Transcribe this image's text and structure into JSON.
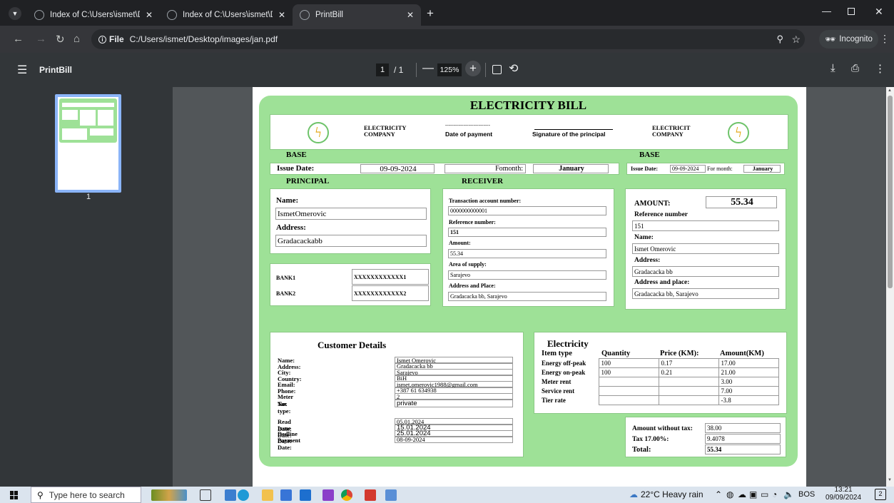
{
  "browser": {
    "tabs": [
      {
        "title": "Index of C:\\Users\\ismet\\Deskto",
        "active": false
      },
      {
        "title": "Index of C:\\Users\\ismet\\Deskto",
        "active": false
      },
      {
        "title": "PrintBill",
        "active": true
      }
    ],
    "new_tab": "+",
    "url_scheme": "File",
    "url": "C:/Users/ismet/Desktop/images/jan.pdf",
    "incognito_label": "Incognito"
  },
  "viewer": {
    "doc_title": "PrintBill",
    "page_current": "1",
    "page_total": "/ 1",
    "zoom": "125%",
    "thumb_label": "1"
  },
  "bill": {
    "title": "ELECTRICITY BILL",
    "header": {
      "company_left": "ELECTRICITY\nCOMPANY",
      "dashes": "---------------------------",
      "date_of_payment": "Date of payment",
      "signature": "Signature of the principal",
      "company_right": "ELECTRICIT\nCOMPANY"
    },
    "base_left": {
      "heading": "BASE",
      "issue_label": "Issue Date:",
      "issue_value": "09-09-2024",
      "for_month_label": "Fomonth:",
      "month_value": "January"
    },
    "base_right": {
      "heading": "BASE",
      "issue_label": "Issue Date:",
      "issue_value": "09-09-2024",
      "for_month_label": "For month:",
      "month_value": "January"
    },
    "principal": {
      "heading": "PRINCIPAL",
      "name_label": "Name:",
      "name_value": "IsmetOmerovic",
      "address_label": "Address:",
      "address_value": "Gradacackabb"
    },
    "banks": [
      {
        "label": "BANK1",
        "value": "XXXXXXXXXXXX1"
      },
      {
        "label": "BANK2",
        "value": "XXXXXXXXXXXX2"
      }
    ],
    "receiver": {
      "heading": "RECEIVER",
      "tan_label": "Transaction account number:",
      "tan_value": "0000000000001",
      "ref_label": "Reference number:",
      "ref_value": "151",
      "amount_label": "Amount:",
      "amount_value": "55.34",
      "area_label": "Area of supply:",
      "area_value": "Sarajevo",
      "addr_label": "Address and Place:",
      "addr_value": "Gradacacka bb, Sarajevo"
    },
    "slip": {
      "amount_label": "AMOUNT:",
      "amount_value": "55.34",
      "ref_label": "Reference number",
      "ref_value": "151",
      "name_label": "Name:",
      "name_value": "Ismet Omerovic",
      "address_label": "Address:",
      "address_value": "Gradacacka bb",
      "place_label": "Address and place:",
      "place_value": "Gradacacka bb, Sarajevo"
    },
    "customer": {
      "heading": "Customer Details",
      "rows": [
        {
          "label": "Name:",
          "value": "Ismet Omerovic"
        },
        {
          "label": "Address:",
          "value": "Gradacacka bb"
        },
        {
          "label": "City:",
          "value": "Sarajevo"
        },
        {
          "label": "Country:",
          "value": "BiH"
        },
        {
          "label": "Email:",
          "value": "ismet.omerovic1988@gmail.com"
        },
        {
          "label": "Phone:",
          "value": "+387 61 634938"
        },
        {
          "label": "Meter No:",
          "value": "2"
        },
        {
          "label": "Tax type:",
          "value": "private"
        }
      ],
      "dates": [
        {
          "label": "Read Date:",
          "value": "05.01.2024"
        },
        {
          "label": "Issue Date:",
          "value": "15.01.2024"
        },
        {
          "label": "Dedline Date:",
          "value": "25.01.2024"
        },
        {
          "label": "Payment Date:",
          "value": "08-09-2024"
        }
      ]
    },
    "electricity": {
      "heading": "Electricity",
      "col_item": "Item type",
      "col_qty": "Quantity",
      "col_price": "Price (KM):",
      "col_amount": "Amount(KM)",
      "rows": [
        {
          "item": "Energy off-peak",
          "qty": "100",
          "price": "0.17",
          "amount": "17.00"
        },
        {
          "item": "Energy on-peak",
          "qty": "100",
          "price": "0.21",
          "amount": "21.00"
        },
        {
          "item": "Meter rent",
          "qty": "",
          "price": "",
          "amount": "3.00"
        },
        {
          "item": "Service rent",
          "qty": "",
          "price": "",
          "amount": "7.00"
        },
        {
          "item": "Tier rate",
          "qty": "",
          "price": "",
          "amount": "-3.8"
        }
      ]
    },
    "totals": {
      "without_tax_label": "Amount without tax:",
      "without_tax_value": "38.00",
      "tax_label": "Tax 17.00%:",
      "tax_value": "9.4078",
      "total_label": "Total:",
      "total_value": "55.34"
    }
  },
  "taskbar": {
    "search_placeholder": "Type here to search",
    "weather": "22°C  Heavy rain",
    "lang": "BOS",
    "time": "13:21",
    "date": "09/09/2024",
    "notif_count": "2"
  }
}
